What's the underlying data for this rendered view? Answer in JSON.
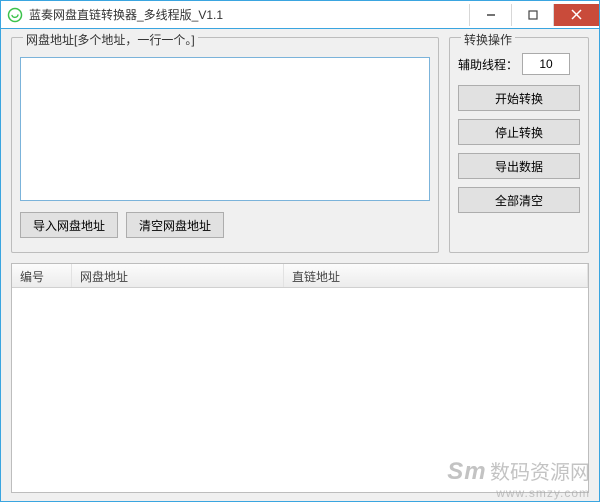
{
  "window": {
    "title": "蓝奏网盘直链转换器_多线程版_V1.1"
  },
  "input_panel": {
    "label": "网盘地址[多个地址，一行一个。]",
    "import_btn": "导入网盘地址",
    "clear_btn": "清空网盘地址",
    "textarea_value": ""
  },
  "ops_panel": {
    "label": "转换操作",
    "thread_label": "辅助线程：",
    "thread_value": "10",
    "start_btn": "开始转换",
    "stop_btn": "停止转换",
    "export_btn": "导出数据",
    "clear_all_btn": "全部清空"
  },
  "table": {
    "col_index": "编号",
    "col_src": "网盘地址",
    "col_dst": "直链地址",
    "rows": []
  },
  "watermark": {
    "brand_en": "Sm",
    "brand_zh": "数码资源网",
    "url": "www.smzy.com"
  }
}
